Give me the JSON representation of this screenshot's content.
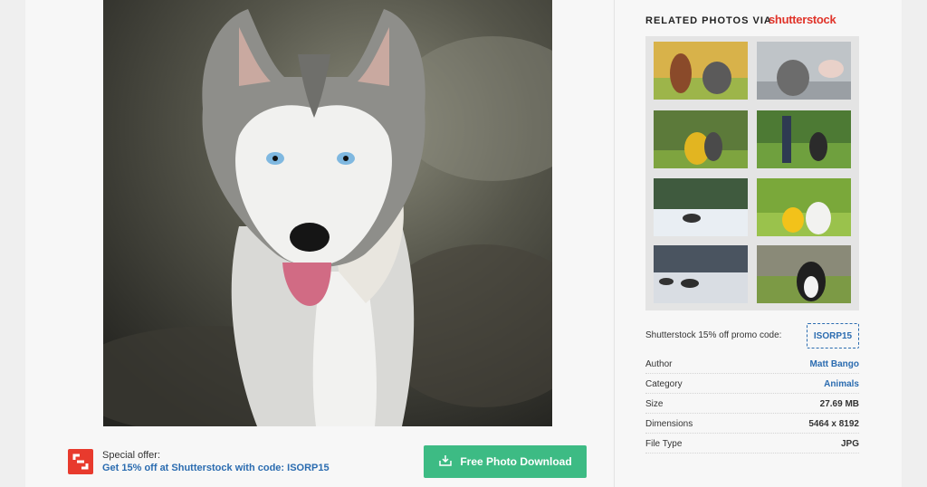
{
  "sidebar": {
    "related_title": "RELATED PHOTOS VIA",
    "brand": "shutterstock",
    "promo_label": "Shutterstock 15% off promo code:",
    "promo_code": "ISORP15",
    "meta": {
      "author_label": "Author",
      "author_value": "Matt Bango",
      "category_label": "Category",
      "category_value": "Animals",
      "size_label": "Size",
      "size_value": "27.69 MB",
      "dimensions_label": "Dimensions",
      "dimensions_value": "5464 x 8192",
      "filetype_label": "File Type",
      "filetype_value": "JPG"
    }
  },
  "offer": {
    "label": "Special offer:",
    "text": "Get 15% off at Shutterstock with code: ISORP15"
  },
  "download": {
    "label": "Free Photo Download",
    "icon": "download-icon"
  },
  "colors": {
    "accent_green": "#3dbb84",
    "link_blue": "#2b6cb0",
    "brand_red": "#e0342a"
  }
}
